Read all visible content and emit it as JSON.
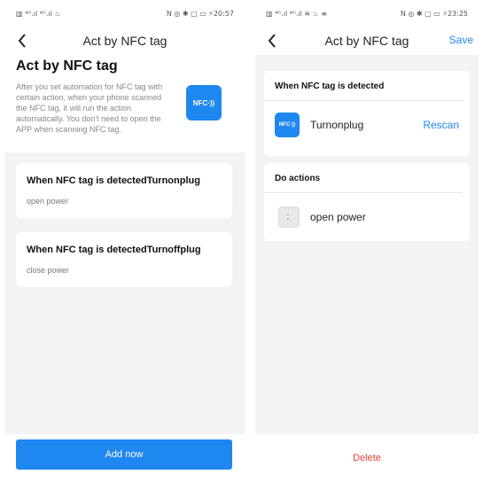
{
  "left": {
    "status": {
      "left": "▥ ⁴ᴳ.ıl ⁴ᴳ.ıl ♨",
      "right": "N ◎ ✱ ▢ ▭ ⚡20:57"
    },
    "nav": {
      "title": "Act by NFC tag"
    },
    "page_title": "Act by NFC tag",
    "intro": "After you set automation for NFC tag with certain action, when your phone scanned the NFC tag, it will run the action automatically. You don't need to open the APP when scanning NFC tag.",
    "nfc_badge": "NFC·))",
    "cards": [
      {
        "title": "When NFC tag is detectedTurnonplug",
        "sub": "open  power"
      },
      {
        "title": "When NFC tag is detectedTurnoffplug",
        "sub": "close  power"
      }
    ],
    "add_button": "Add now"
  },
  "right": {
    "status": {
      "left": "▥ ⁴ᴳ.ıl ⁴ᴳ.ıl ≋ ♨ ≡",
      "right": "N ◎ ✱ ▢ ▭ ⚡23:25"
    },
    "nav": {
      "title": "Act by NFC tag",
      "save": "Save"
    },
    "detected_header": "When NFC tag is detected",
    "tag_icon": "NFC·))",
    "tag_name": "Turnonplug",
    "rescan": "Rescan",
    "actions_header": "Do actions",
    "action": "open  power",
    "delete": "Delete"
  },
  "colors": {
    "accent": "#1f87f0",
    "danger": "#e0433b",
    "background": "#f3f3f3"
  }
}
